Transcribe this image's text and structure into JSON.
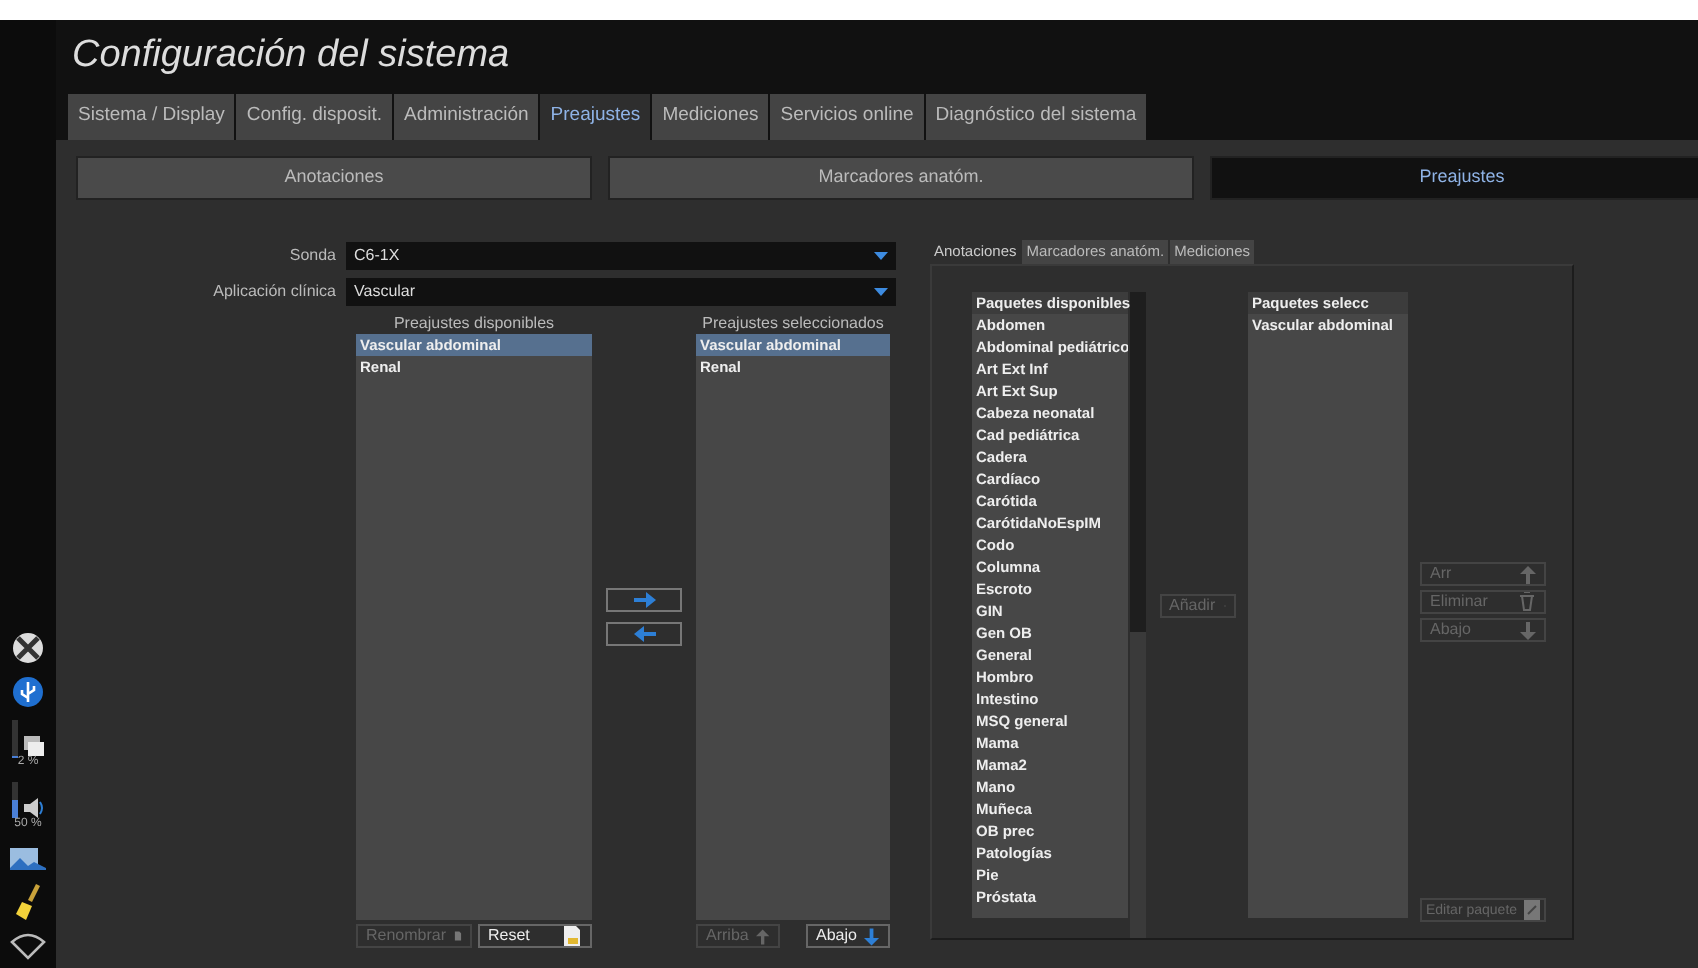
{
  "title": "Configuración del sistema",
  "tabs": [
    {
      "label": "Sistema / Display",
      "selected": false
    },
    {
      "label": "Config. disposit.",
      "selected": false
    },
    {
      "label": "Administración",
      "selected": false
    },
    {
      "label": "Preajustes",
      "selected": true
    },
    {
      "label": "Mediciones",
      "selected": false
    },
    {
      "label": "Servicios online",
      "selected": false
    },
    {
      "label": "Diagnóstico del sistema",
      "selected": false
    }
  ],
  "subtabs": [
    {
      "label": "Anotaciones",
      "selected": false
    },
    {
      "label": "Marcadores anatóm.",
      "selected": false
    },
    {
      "label": "Preajustes",
      "selected": true
    }
  ],
  "fields": [
    {
      "label": "Sonda",
      "value": "C6-1X"
    },
    {
      "label": "Aplicación clínica",
      "value": "Vascular"
    }
  ],
  "available_presets": {
    "heading": "Preajustes disponibles",
    "items": [
      {
        "label": "Vascular abdominal",
        "selected": true
      },
      {
        "label": "Renal",
        "selected": false
      }
    ],
    "buttons": [
      {
        "kind": "rename",
        "label": "Renombrar",
        "disabled": true
      },
      {
        "kind": "reset",
        "label": "Reset",
        "disabled": false
      }
    ]
  },
  "transfer_buttons": [
    {
      "kind": "right"
    },
    {
      "kind": "left"
    }
  ],
  "selected_presets": {
    "heading": "Preajustes seleccionados",
    "items": [
      {
        "label": "Vascular abdominal",
        "selected": true
      },
      {
        "label": "Renal",
        "selected": false
      }
    ],
    "buttons": [
      {
        "kind": "up",
        "label": "Arriba",
        "disabled": true
      },
      {
        "kind": "down",
        "label": "Abajo",
        "disabled": false
      }
    ]
  },
  "package_tabs": [
    {
      "label": "Anotaciones",
      "selected": true
    },
    {
      "label": "Marcadores anatóm.",
      "selected": false
    },
    {
      "label": "Mediciones",
      "selected": false
    }
  ],
  "available_packages": {
    "heading": "Paquetes disponibles",
    "items": [
      "Abdomen",
      "Abdominal pediátrico",
      "Art Ext Inf",
      "Art Ext Sup",
      "Cabeza neonatal",
      "Cad pediátrica",
      "Cadera",
      "Cardíaco",
      "Carótida",
      "CarótidaNoEspIM",
      "Codo",
      "Columna",
      "Escroto",
      "GIN",
      "Gen OB",
      "General",
      "Hombro",
      "Intestino",
      "MSQ general",
      "Mama",
      "Mama2",
      "Mano",
      "Muñeca",
      "OB prec",
      "Patologías",
      "Pie",
      "Próstata"
    ]
  },
  "add_button": {
    "kind": "add",
    "label": "Añadir",
    "disabled": true
  },
  "selected_packages": {
    "heading": "Paquetes selecc",
    "items": [
      "Vascular abdominal"
    ]
  },
  "package_buttons": [
    {
      "kind": "up",
      "label": "Arr",
      "disabled": true
    },
    {
      "kind": "delete",
      "label": "Eliminar",
      "disabled": true
    },
    {
      "kind": "down",
      "label": "Abajo",
      "disabled": true
    }
  ],
  "edit_button": {
    "kind": "edit",
    "label": "Editar paquete",
    "disabled": true
  },
  "status_meters": [
    {
      "kind": "disk",
      "reading": "2 %",
      "level": 0.02
    },
    {
      "kind": "volume",
      "reading": "50 %",
      "level": 0.5
    }
  ]
}
